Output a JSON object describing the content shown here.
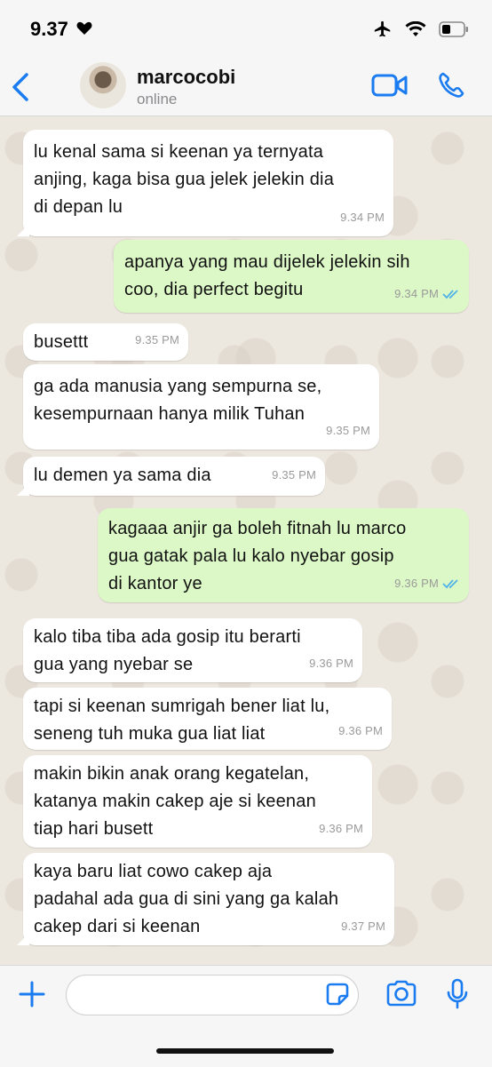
{
  "status_bar": {
    "time": "9.37"
  },
  "header": {
    "contact_name": "marcocobi",
    "presence": "online"
  },
  "messages": [
    {
      "dir": "in",
      "text": "lu kenal sama si keenan ya ternyata\nanjing, kaga bisa gua jelek jelekin dia\ndi depan lu",
      "time": "9.34 PM"
    },
    {
      "dir": "out",
      "text": "apanya yang mau dijelek jelekin sih\ncoo, dia perfect begitu",
      "time": "9.34 PM",
      "read": true
    },
    {
      "dir": "in",
      "text": "busettt",
      "time": "9.35 PM"
    },
    {
      "dir": "in",
      "text": "ga ada manusia yang sempurna se,\nkesempurnaan hanya milik Tuhan",
      "time": "9.35 PM"
    },
    {
      "dir": "in",
      "text": "lu demen ya sama dia",
      "time": "9.35 PM"
    },
    {
      "dir": "out",
      "text": "kagaaa anjir ga boleh fitnah lu marco\ngua gatak pala lu kalo nyebar gosip\ndi kantor ye",
      "time": "9.36 PM",
      "read": true
    },
    {
      "dir": "in",
      "text": "kalo tiba tiba ada gosip itu berarti\ngua yang nyebar se",
      "time": "9.36 PM"
    },
    {
      "dir": "in",
      "text": "tapi si keenan sumrigah bener liat lu,\nseneng tuh muka gua liat liat",
      "time": "9.36 PM"
    },
    {
      "dir": "in",
      "text": "makin bikin anak orang kegatelan,\nkatanya makin cakep aje si keenan\ntiap hari busett",
      "time": "9.36 PM"
    },
    {
      "dir": "in",
      "text": "kaya baru liat cowo cakep aja\npadahal ada gua di sini yang ga kalah\ncakep dari si keenan",
      "time": "9.37 PM"
    }
  ],
  "input": {
    "placeholder": ""
  },
  "colors": {
    "accent": "#1a7cf0",
    "outgoing_bubble": "#dcf8c6",
    "incoming_bubble": "#ffffff",
    "read_ticks": "#4fb3e8"
  }
}
